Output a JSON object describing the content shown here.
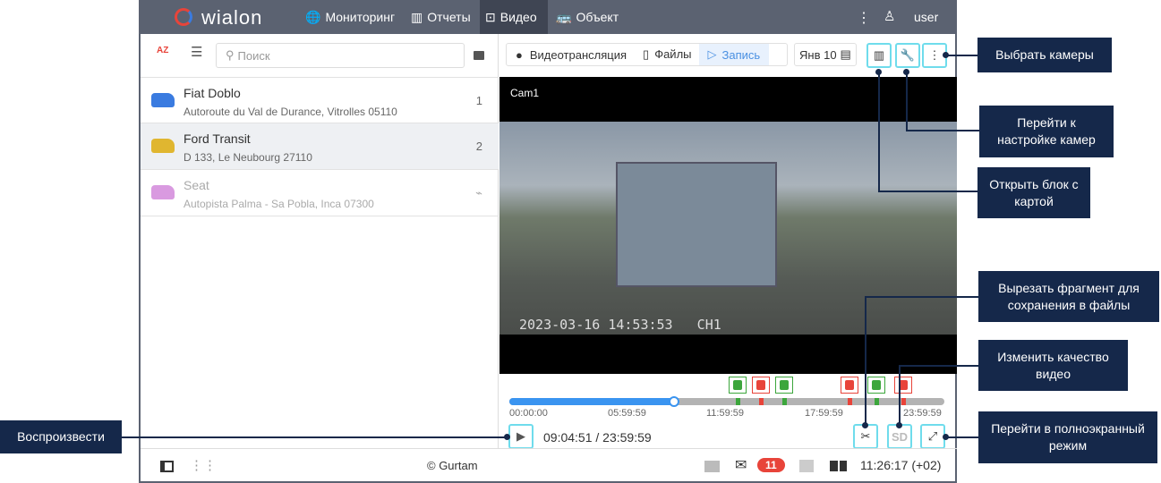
{
  "header": {
    "logo": "wialon",
    "nav": [
      "Мониторинг",
      "Отчеты",
      "Видео",
      "Объект"
    ],
    "user": "user"
  },
  "left": {
    "search_placeholder": "Поиск",
    "sort_label": "AZ",
    "units": [
      {
        "name": "Fiat Doblo",
        "address": "Autoroute du Val de Durance, Vitrolles 05110",
        "count": "1",
        "color": "#3a7be0"
      },
      {
        "name": "Ford Transit",
        "address": "D 133, Le Neubourg 27110",
        "count": "2",
        "color": "#e0b630"
      },
      {
        "name": "Seat",
        "address": "Autopista Palma - Sa Pobla, Inca 07300",
        "count": "",
        "color": "#d99ae0"
      }
    ]
  },
  "toolbar": {
    "tabs": [
      "Видеотрансляция",
      "Файлы",
      "Запись"
    ],
    "date": "Янв 10"
  },
  "video": {
    "camera": "Cam1",
    "overlay": "2023-03-16 14:53:53   CH1"
  },
  "timeline": {
    "progress": 0.378,
    "ticks": [
      "00:00:00",
      "05:59:59",
      "11:59:59",
      "17:59:59",
      "23:59:59"
    ],
    "time": "09:04:51 / 23:59:59",
    "quality": "SD",
    "events": [
      {
        "type": "fuel-fill",
        "color": "#3ca63c"
      },
      {
        "type": "fuel-drain",
        "color": "#e8443a"
      },
      {
        "type": "fuel-fill",
        "color": "#3ca63c"
      },
      {
        "type": "fuel-drain",
        "color": "#e8443a"
      },
      {
        "type": "fuel-fill",
        "color": "#3ca63c"
      },
      {
        "type": "fuel-drain",
        "color": "#e8443a"
      }
    ]
  },
  "footer": {
    "copyright": "© Gurtam",
    "badge": "11",
    "clock": "11:26:17 (+02)"
  },
  "callouts": {
    "cameras": "Выбрать камеры",
    "settings": "Перейти к настройке камер",
    "map": "Открыть блок с картой",
    "cut": "Вырезать фрагмент для сохранения в файлы",
    "quality": "Изменить качество видео",
    "fullscreen": "Перейти в полноэкранный режим",
    "play": "Воспроизвести"
  }
}
